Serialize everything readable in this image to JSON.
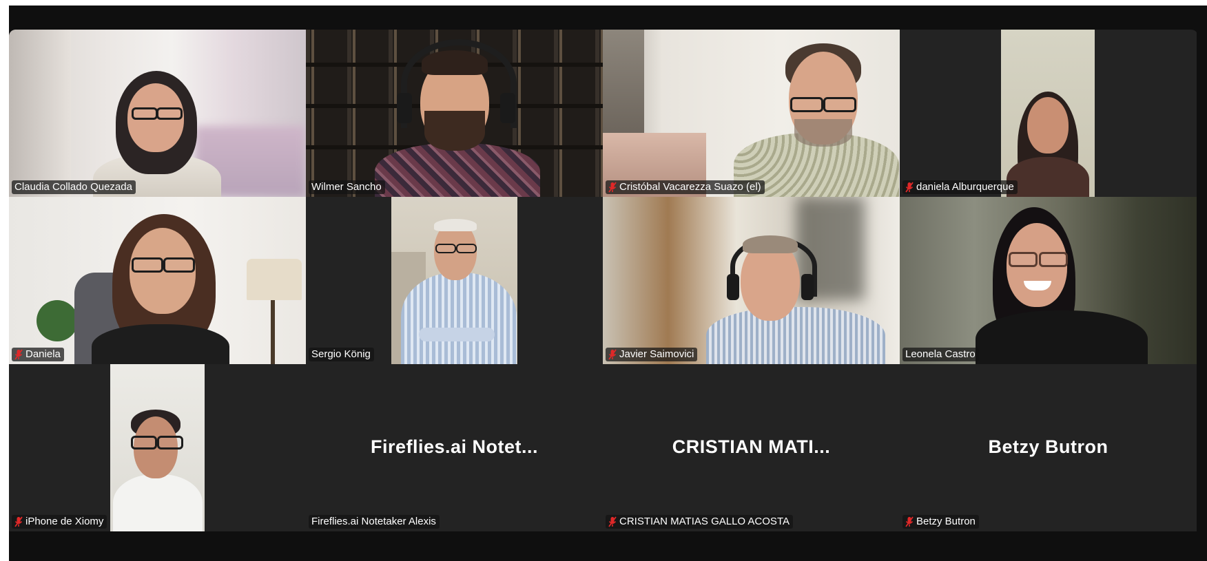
{
  "participants": [
    {
      "name": "Claudia Collado Quezada",
      "muted": false,
      "video": true
    },
    {
      "name": "Wilmer Sancho",
      "muted": false,
      "video": true,
      "active_speaker": true
    },
    {
      "name": "Cristóbal Vacarezza Suazo (el)",
      "muted": true,
      "video": true
    },
    {
      "name": "daniela Alburquerque",
      "muted": true,
      "video": true
    },
    {
      "name": "Daniela",
      "muted": true,
      "video": true
    },
    {
      "name": "Sergio König",
      "muted": false,
      "video": true
    },
    {
      "name": "Javier Saimovici",
      "muted": true,
      "video": true
    },
    {
      "name": "Leonela Castro",
      "muted": false,
      "video": true
    },
    {
      "name": "iPhone de Xiomy",
      "muted": true,
      "video": true
    },
    {
      "name": "Fireflies.ai Notetaker Alexis",
      "muted": false,
      "video": false,
      "display_name": "Fireflies.ai  Notet..."
    },
    {
      "name": "CRISTIAN MATIAS GALLO ACOSTA",
      "muted": true,
      "video": false,
      "display_name": "CRISTIAN  MATI..."
    },
    {
      "name": "Betzy Butron",
      "muted": true,
      "video": false,
      "display_name": "Betzy Butron"
    }
  ],
  "colors": {
    "window_bg": "#0f0f0f",
    "tile_bg": "#232323",
    "active_speaker_border": "#23d962",
    "muted_icon": "#e02828"
  },
  "icons": {
    "muted": "mic-muted-icon"
  }
}
